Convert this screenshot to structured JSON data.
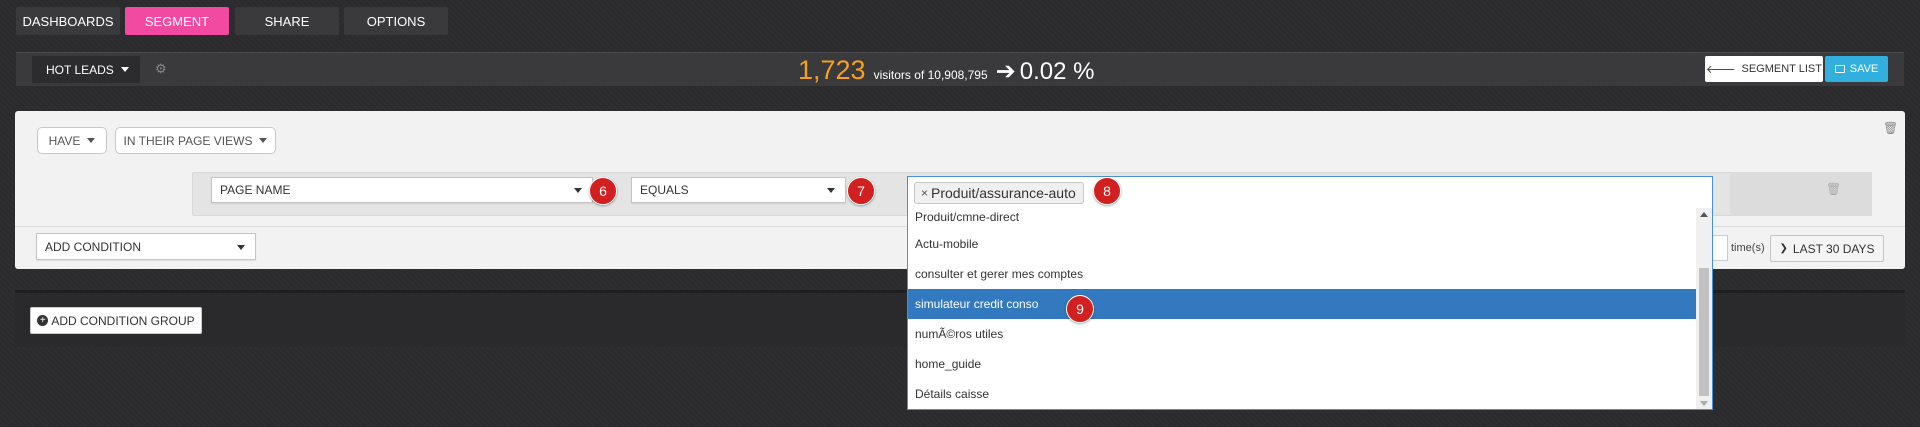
{
  "nav": {
    "tabs": [
      {
        "label": "DASHBOARDS"
      },
      {
        "label": "SEGMENT"
      },
      {
        "label": "SHARE"
      },
      {
        "label": "OPTIONS"
      }
    ]
  },
  "header": {
    "segment_name": "HOT LEADS",
    "visitor_count": "1,723",
    "visitors_of_text": "visitors of 10,908,795",
    "percent": "0.02 %",
    "segment_list_label": "SEGMENT LIST",
    "save_label": "SAVE"
  },
  "condition": {
    "have_label": "HAVE",
    "scope_label": "IN THEIR PAGE VIEWS",
    "field_label": "PAGE NAME",
    "operator_label": "EQUALS",
    "selected_tag": "Produit/assurance-auto",
    "options": [
      {
        "label": "Produit/cmne-direct"
      },
      {
        "label": "Actu-mobile"
      },
      {
        "label": "consulter et gerer mes comptes"
      },
      {
        "label": "simulateur credit conso"
      },
      {
        "label": "numÃ©ros utiles"
      },
      {
        "label": "home_guide"
      },
      {
        "label": "Détails caisse"
      }
    ],
    "highlighted_index": 3,
    "add_condition_label": "ADD CONDITION",
    "times_label": "time(s)",
    "period_label": "LAST 30 DAYS"
  },
  "group": {
    "add_group_label": "ADD CONDITION GROUP"
  },
  "annotations": {
    "b6": "6",
    "b7": "7",
    "b8": "8",
    "b9": "9"
  },
  "colors": {
    "active_tab": "#f24aa0",
    "visitor_count": "#f4a020",
    "save_button": "#31b0e0",
    "highlight": "#3379c0",
    "badge": "#d22020"
  }
}
